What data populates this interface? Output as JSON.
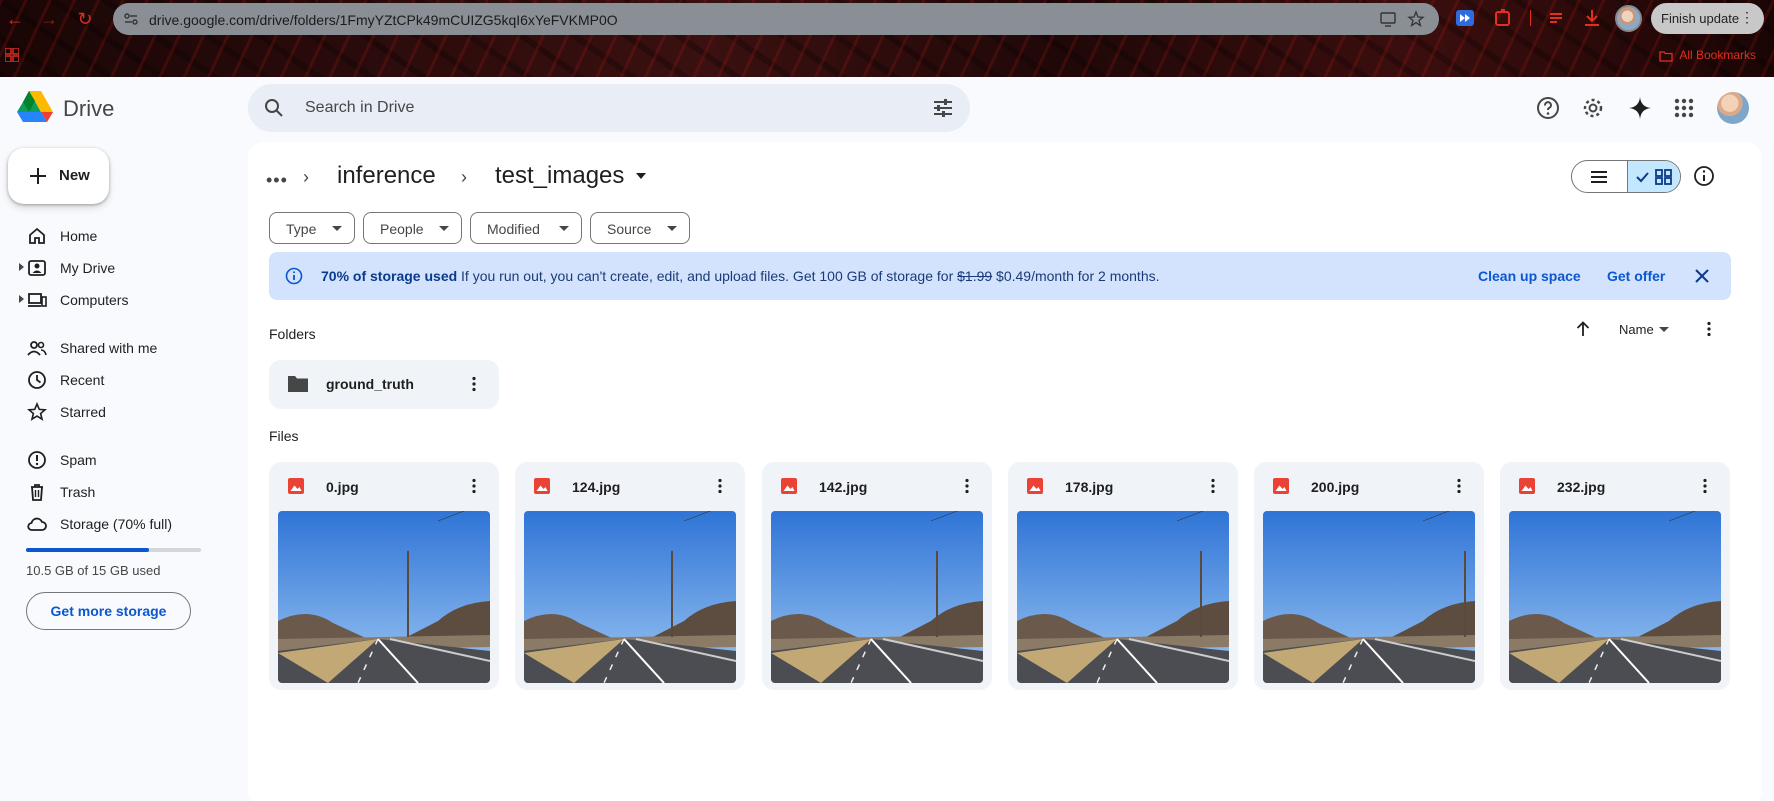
{
  "browser": {
    "url": "drive.google.com/drive/folders/1FmyYZtCPk49mCUIZG5kqI6xYeFVKMP0O",
    "finish_update_label": "Finish update",
    "bookmarks_label": "All Bookmarks",
    "accent_color": "#d93025"
  },
  "app": {
    "brand": "Drive",
    "search_placeholder": "Search in Drive"
  },
  "sidebar": {
    "new_label": "New",
    "items": [
      {
        "label": "Home",
        "icon": "home-icon"
      },
      {
        "label": "My Drive",
        "icon": "my-drive-icon"
      },
      {
        "label": "Computers",
        "icon": "computers-icon"
      },
      {
        "label": "Shared with me",
        "icon": "shared-icon"
      },
      {
        "label": "Recent",
        "icon": "clock-icon"
      },
      {
        "label": "Starred",
        "icon": "star-icon"
      },
      {
        "label": "Spam",
        "icon": "spam-icon"
      },
      {
        "label": "Trash",
        "icon": "trash-icon"
      },
      {
        "label": "Storage (70% full)",
        "icon": "cloud-icon"
      }
    ],
    "storage_used_fraction": 0.7,
    "storage_text": "10.5 GB of 15 GB used",
    "get_more_storage": "Get more storage"
  },
  "breadcrumb": {
    "parent": "inference",
    "current": "test_images"
  },
  "filters": [
    "Type",
    "People",
    "Modified",
    "Source"
  ],
  "banner": {
    "bold": "70% of storage used",
    "text_before_price": " If you run out, you can't create, edit, and upload files. Get 100 GB of storage for ",
    "old_price": "$1.99",
    "text_after_price": " $0.49/month for 2 months.",
    "clean_up": "Clean up space",
    "get_offer": "Get offer"
  },
  "folders_section": {
    "title": "Folders",
    "sort_label": "Name",
    "items": [
      {
        "name": "ground_truth"
      }
    ]
  },
  "files_section": {
    "title": "Files",
    "items": [
      {
        "name": "0.jpg"
      },
      {
        "name": "124.jpg"
      },
      {
        "name": "142.jpg"
      },
      {
        "name": "178.jpg"
      },
      {
        "name": "200.jpg"
      },
      {
        "name": "232.jpg"
      }
    ]
  }
}
